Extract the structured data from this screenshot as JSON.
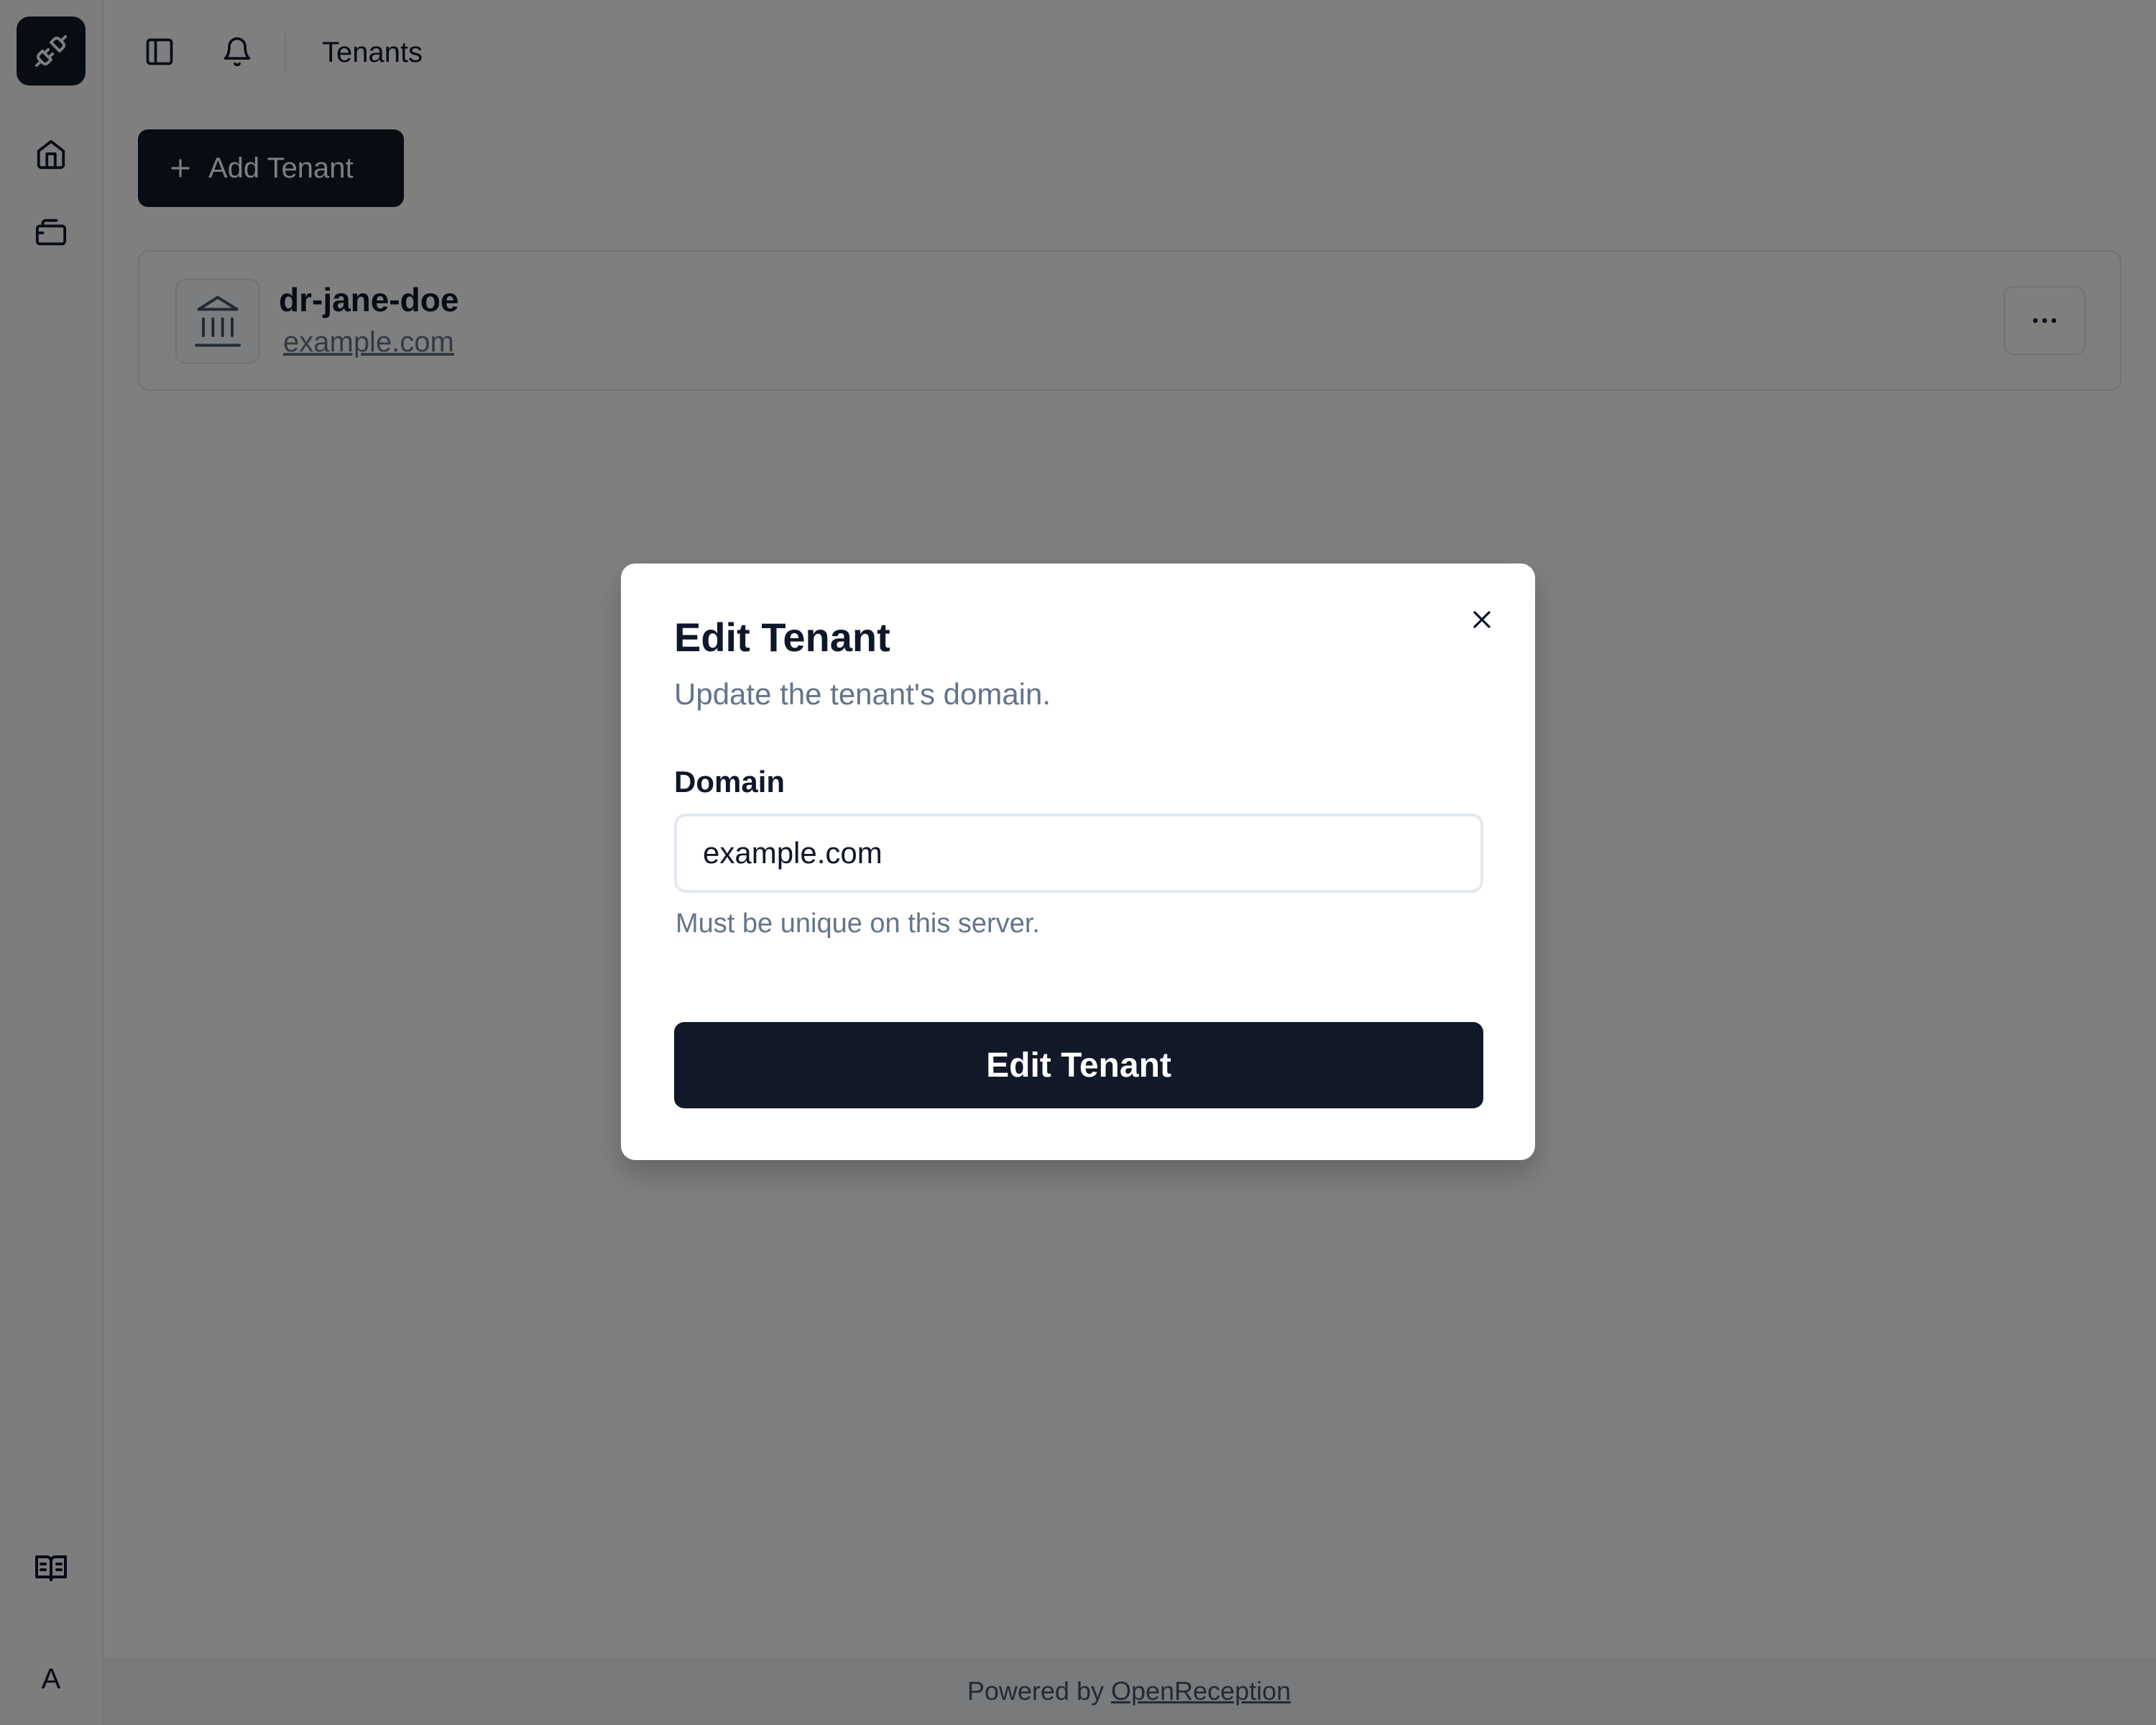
{
  "sidebar": {
    "logo_icon": "plug-icon",
    "items": [
      {
        "icon": "home-icon"
      },
      {
        "icon": "ticket-icon"
      }
    ],
    "docs_icon": "book-icon",
    "avatar_initial": "A"
  },
  "topbar": {
    "toggle_icon": "sidebar-toggle-icon",
    "notification_icon": "bell-icon",
    "breadcrumb": "Tenants"
  },
  "main": {
    "add_button_label": "Add Tenant",
    "tenants": [
      {
        "name": "dr-jane-doe",
        "domain": "example.com"
      }
    ]
  },
  "footer": {
    "prefix": "Powered by",
    "link": "OpenReception"
  },
  "modal": {
    "title": "Edit Tenant",
    "description": "Update the tenant's domain.",
    "field_label": "Domain",
    "field_value": "example.com",
    "field_help": "Must be unique on this server.",
    "submit_label": "Edit Tenant"
  },
  "colors": {
    "primary": "#111827",
    "muted_text": "#64748b",
    "overlay": "rgba(0,0,0,0.5)"
  }
}
